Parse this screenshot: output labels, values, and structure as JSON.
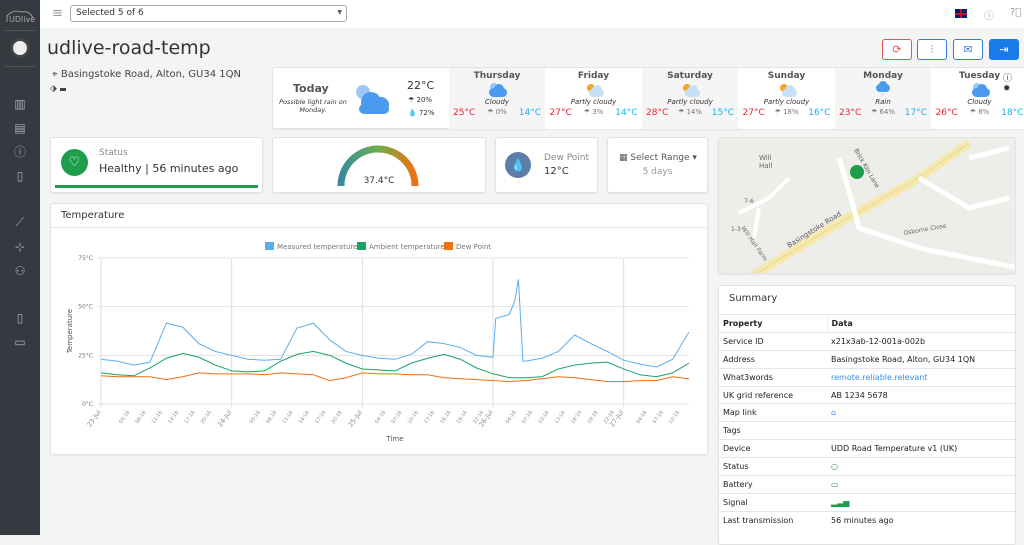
{
  "app": {
    "logo_text": "UDlive"
  },
  "sidebar": {
    "items": [
      "map-icon",
      "list-icon",
      "alert-icon",
      "clipboard-icon",
      "chart-icon",
      "antenna-icon",
      "users-icon",
      "document-icon",
      "id-card-icon"
    ]
  },
  "topbar": {
    "selector_value": "Selected 5 of 6",
    "language": "en-GB"
  },
  "page": {
    "title": "udlive-road-temp",
    "address": "Basingstoke Road, Alton, GU34 1QN"
  },
  "weather": {
    "today": {
      "label": "Today",
      "note": "Possible light rain on Monday.",
      "temp": "22°C",
      "precip": "20%",
      "humidity": "72%"
    },
    "days": [
      {
        "name": "Thursday",
        "desc": "Cloudy",
        "hi": "25°C",
        "precip": "0%",
        "lo": "14°C",
        "icon": "cloud"
      },
      {
        "name": "Friday",
        "desc": "Partly cloudy",
        "hi": "27°C",
        "precip": "3%",
        "lo": "14°C",
        "icon": "sun-cloud"
      },
      {
        "name": "Saturday",
        "desc": "Partly cloudy",
        "hi": "28°C",
        "precip": "14%",
        "lo": "15°C",
        "icon": "sun-cloud"
      },
      {
        "name": "Sunday",
        "desc": "Partly cloudy",
        "hi": "27°C",
        "precip": "18%",
        "lo": "16°C",
        "icon": "sun-cloud"
      },
      {
        "name": "Monday",
        "desc": "Rain",
        "hi": "23°C",
        "precip": "64%",
        "lo": "17°C",
        "icon": "rain"
      },
      {
        "name": "Tuesday",
        "desc": "Cloudy",
        "hi": "26°C",
        "precip": "8%",
        "lo": "18°C",
        "icon": "cloud"
      }
    ]
  },
  "status": {
    "label": "Status",
    "value": "Healthy | 56 minutes ago",
    "color": "#1e9e4a"
  },
  "gauge": {
    "value": "37.4°C",
    "level": 0.6
  },
  "dewpoint": {
    "label": "Dew Point",
    "value": "12°C"
  },
  "range": {
    "label": "Select Range",
    "value": "5 days"
  },
  "temperature_card": {
    "title": "Temperature"
  },
  "chart_data": {
    "type": "line",
    "xlabel": "Time",
    "ylabel": "Temperature",
    "ylim": [
      0,
      75
    ],
    "yticks": [
      "0°C",
      "25°C",
      "50°C",
      "75°C"
    ],
    "legend": "top",
    "grid": true,
    "xticks": [
      "23-Jul",
      "05:16",
      "08:16",
      "11:16",
      "14:16",
      "17:16",
      "20:16",
      "24-Jul",
      "05:16",
      "08:16",
      "11:16",
      "14:16",
      "17:16",
      "20:16",
      "25-Jul",
      "04:16",
      "07:16",
      "10:16",
      "13:16",
      "16:16",
      "19:16",
      "22:16",
      "26-Jul",
      "04:16",
      "07:16",
      "10:16",
      "13:16",
      "16:16",
      "19:16",
      "22:16",
      "27-Jul",
      "04:16",
      "07:16",
      "10:16"
    ],
    "x": [
      "23-Jul 00:00",
      "23-Jul 03:00",
      "23-Jul 06:00",
      "23-Jul 09:00",
      "23-Jul 12:00",
      "23-Jul 15:00",
      "23-Jul 18:00",
      "23-Jul 21:00",
      "24-Jul 00:00",
      "24-Jul 03:00",
      "24-Jul 06:00",
      "24-Jul 09:00",
      "24-Jul 12:00",
      "24-Jul 15:00",
      "24-Jul 18:00",
      "24-Jul 21:00",
      "25-Jul 00:00",
      "25-Jul 03:00",
      "25-Jul 06:00",
      "25-Jul 09:00",
      "25-Jul 12:00",
      "25-Jul 15:00",
      "25-Jul 18:00",
      "25-Jul 21:00",
      "26-Jul 00:00",
      "26-Jul 00:30",
      "26-Jul 03:00",
      "26-Jul 04:00",
      "26-Jul 04:40",
      "26-Jul 05:30",
      "26-Jul 06:00",
      "26-Jul 09:00",
      "26-Jul 12:00",
      "26-Jul 15:00",
      "26-Jul 18:00",
      "26-Jul 21:00",
      "27-Jul 00:00",
      "27-Jul 03:00",
      "27-Jul 06:00",
      "27-Jul 09:00",
      "27-Jul 12:00"
    ],
    "series": [
      {
        "name": "Measured temperature",
        "color": "#5aaff0",
        "values": [
          23,
          22,
          20,
          21.5,
          41.5,
          39.5,
          31,
          27,
          25,
          23,
          22.5,
          23,
          39,
          41.5,
          33,
          27,
          25,
          23.5,
          23,
          25.5,
          32,
          31,
          29,
          25,
          24,
          44,
          46,
          53,
          64,
          22,
          22,
          23.5,
          27,
          35.5,
          31,
          27,
          22.5,
          20.5,
          19,
          23,
          37
        ]
      },
      {
        "name": "Ambient temperature",
        "color": "#1aa260",
        "values": [
          16,
          15,
          14.5,
          18.5,
          23.5,
          26,
          24,
          20,
          17,
          16.5,
          17,
          22,
          25.5,
          27,
          25,
          21,
          18,
          17.5,
          17,
          21,
          23.5,
          25.5,
          23,
          18.5,
          15.5,
          15.2,
          13.5,
          13.5,
          13.5,
          13.5,
          13.5,
          14,
          18,
          20,
          21,
          21.5,
          18,
          15,
          14,
          16,
          21
        ]
      },
      {
        "name": "Dew Point",
        "color": "#f07010",
        "values": [
          14.5,
          14,
          14,
          14,
          12.5,
          14,
          16,
          15.5,
          15.5,
          15.5,
          15,
          16,
          15.5,
          15,
          12,
          13.5,
          16,
          15.5,
          15.5,
          15,
          15,
          13.5,
          13,
          12.5,
          12,
          12,
          11.5,
          11.7,
          11.8,
          12,
          12,
          13,
          14,
          13.5,
          12.5,
          11.5,
          11.5,
          12,
          12,
          14,
          13
        ]
      }
    ]
  },
  "summary": {
    "title": "Summary",
    "headers": [
      "Property",
      "Data"
    ],
    "rows": [
      [
        "Service ID",
        "x21x3ab-12-001a-002b"
      ],
      [
        "Address",
        "Basingstoke Road, Alton, GU34 1QN"
      ],
      [
        "What3words",
        "remote.reliable.relevant"
      ],
      [
        "UK grid reference",
        "AB 1234 5678"
      ],
      [
        "Map link",
        ""
      ],
      [
        "Tags",
        ""
      ],
      [
        "Device",
        "UDD Road Temperature v1 (UK)"
      ],
      [
        "Status",
        ""
      ],
      [
        "Battery",
        ""
      ],
      [
        "Signal",
        ""
      ],
      [
        "Last transmission",
        "56 minutes ago"
      ]
    ]
  },
  "map": {
    "labels": [
      "Will Hall",
      "Brick Kiln Lane",
      "7-6",
      "Will Hall Farm",
      "1-3",
      "Basingstoke Road",
      "Osborne Close"
    ]
  }
}
